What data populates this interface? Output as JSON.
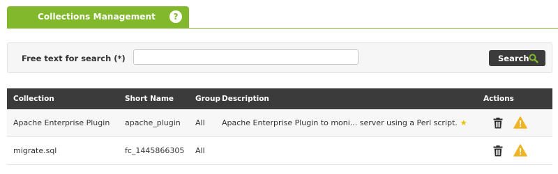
{
  "tab": {
    "title": "Collections Management",
    "help": "?"
  },
  "search": {
    "label": "Free text for search (*)",
    "value": "",
    "button": "Search"
  },
  "table": {
    "headers": [
      "Collection",
      "Short Name",
      "Group",
      "Description",
      "Actions"
    ],
    "rows": [
      {
        "collection": "Apache Enterprise Plugin",
        "short_name": "apache_plugin",
        "group": "All",
        "description": "Apache Enterprise Plugin to moni... server using a Perl script."
      },
      {
        "collection": "migrate.sql",
        "short_name": "fc_1445866305",
        "group": "All",
        "description": ""
      }
    ]
  },
  "colors": {
    "accent": "#82b92c",
    "header_dark": "#3b3b3b",
    "warning": "#f0b323",
    "star": "#e6c200"
  },
  "icons": {
    "help": "help-icon",
    "search": "magnifier-icon",
    "delete": "trash-icon",
    "warning": "warning-triangle-icon",
    "star": "star-icon"
  }
}
